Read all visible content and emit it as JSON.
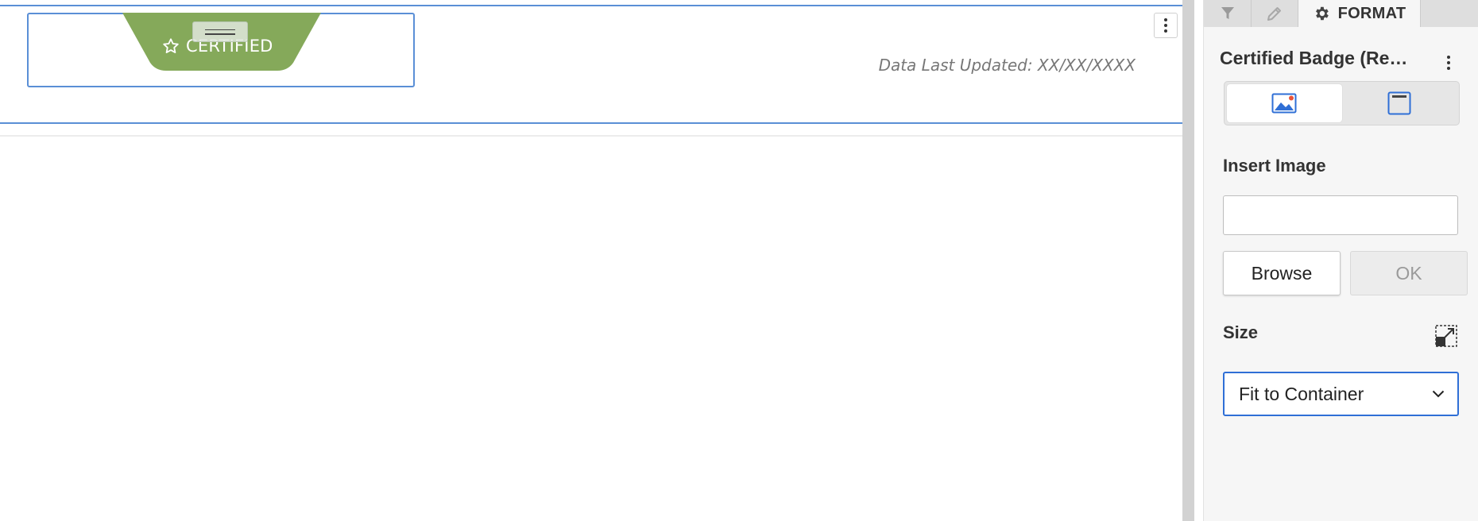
{
  "canvas": {
    "badge": {
      "text": "CERTIFIED",
      "color": "#85a95a",
      "icon": "star-outline-icon"
    },
    "data_updated_text": "Data Last Updated: XX/XX/XXXX",
    "selection_color": "#5a8fd6"
  },
  "panel": {
    "tabs": [
      {
        "name": "filter",
        "icon": "filter-icon",
        "label": ""
      },
      {
        "name": "edit",
        "icon": "pencil-icon",
        "label": ""
      },
      {
        "name": "format",
        "icon": "gear-icon",
        "label": "FORMAT",
        "active": true
      }
    ],
    "title": "Certified Badge (Re…",
    "view_toggle": [
      {
        "icon": "image-icon",
        "active": true
      },
      {
        "icon": "container-icon",
        "active": false
      }
    ],
    "insert_image": {
      "label": "Insert Image",
      "value": "",
      "placeholder": "",
      "browse_label": "Browse",
      "ok_label": "OK"
    },
    "size": {
      "label": "Size",
      "selected": "Fit to Container",
      "icon": "resize-icon"
    }
  }
}
